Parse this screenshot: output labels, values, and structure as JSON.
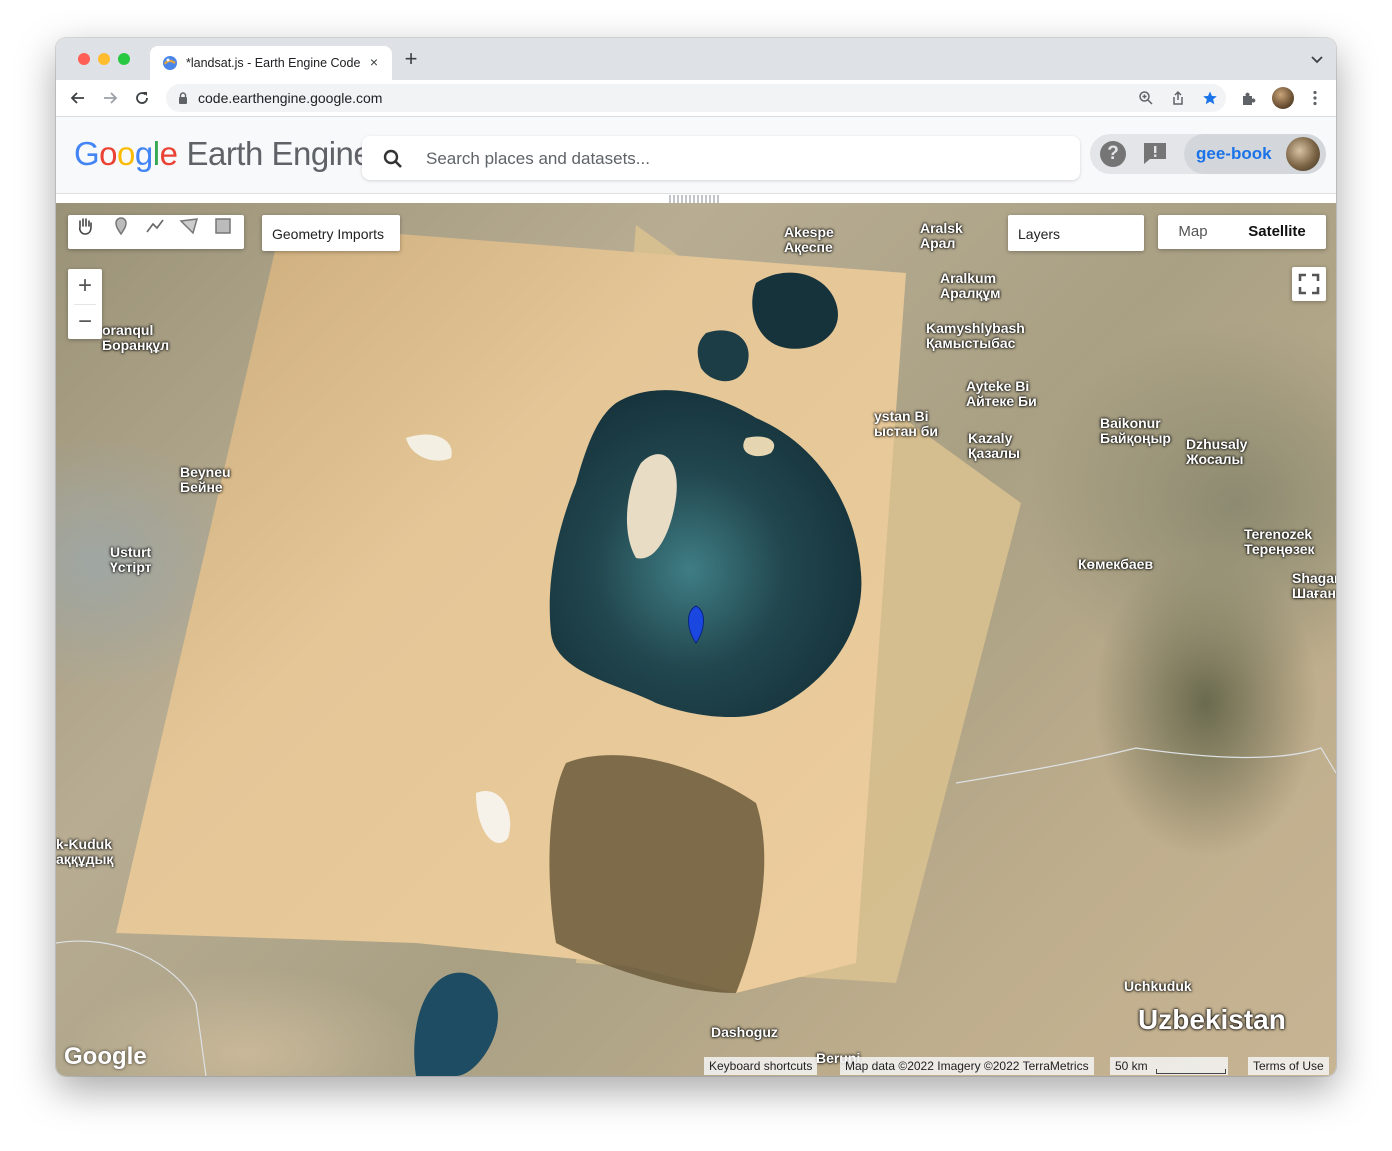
{
  "browser": {
    "tab_title": "*landsat.js - Earth Engine Code Editor",
    "url": "code.earthengine.google.com",
    "new_tab": "+",
    "close_tab": "×"
  },
  "header": {
    "logo_google": [
      "G",
      "o",
      "o",
      "g",
      "l",
      "e"
    ],
    "logo_product": "Earth Engine",
    "search_placeholder": "Search places and datasets...",
    "help": "?",
    "username": "gee-book"
  },
  "map": {
    "geometry_imports": "Geometry Imports",
    "layers": "Layers",
    "map_type": {
      "map": "Map",
      "satellite": "Satellite",
      "selected": "Satellite"
    },
    "zoom_in": "+",
    "zoom_out": "−",
    "watermark": "Google",
    "attribution": {
      "keyboard": "Keyboard shortcuts",
      "data": "Map data ©2022 Imagery ©2022 TerraMetrics",
      "scale": "50 km",
      "terms": "Terms of Use"
    },
    "places": {
      "akespe": "Akespe\nАқеспе",
      "aralsk": "Aralsk\nАрал",
      "aralkum": "Aralkum\nАралқұм",
      "kamyshlybash": "Kamyshlybash\nҚамыстыбас",
      "ayteke": "Ayteke Bi\nАйтеке Би",
      "baikonur": "Baikonur\nБайқоңыр",
      "dzhusaly": "Dzhusaly\nЖосалы",
      "zhalagash": "ystan Bi\nыстан би",
      "kazaly": "Kazaly\nҚазалы",
      "terenozek": "Terenozek\nТереңөзек",
      "komekbaev": "Көмекбаев",
      "shagan": "Shagan\nШаған",
      "beyneu": "Beyneu\nБейне",
      "ustyurt": "Usturt\nҮстірт",
      "boranqul": "oranqul\nБоранқұл",
      "akkuduk": "k-Kuduk\nаққұдық",
      "uchkuduk": "Uchkuduk",
      "uzbekistan": "Uzbekistan",
      "dashoguz": "Dashoguz",
      "beruni": "Beruni"
    }
  }
}
